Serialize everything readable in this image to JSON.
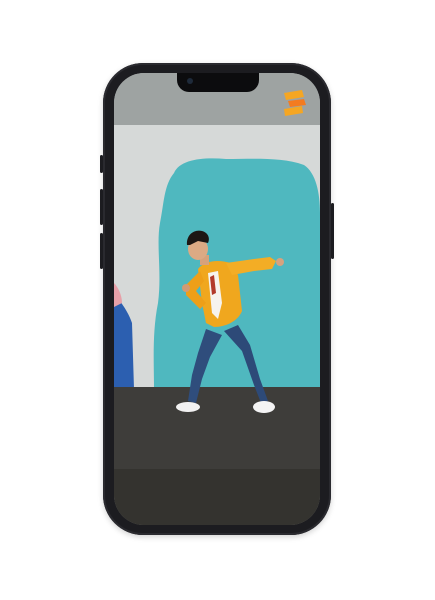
{
  "screen": {
    "app_logo_icon": "orange-stacked-bars-logo",
    "content_type": "video-player",
    "colors": {
      "phone_frame": "#1c1c20",
      "wall": "#d9dcdb",
      "wall_top": "#9fa4a3",
      "backdrop_teal": "#4fb8bf",
      "floor": "#3e3d3a",
      "jacket": "#f0a71e",
      "jeans": "#2d4a78",
      "logo_orange": "#f47b20"
    }
  }
}
